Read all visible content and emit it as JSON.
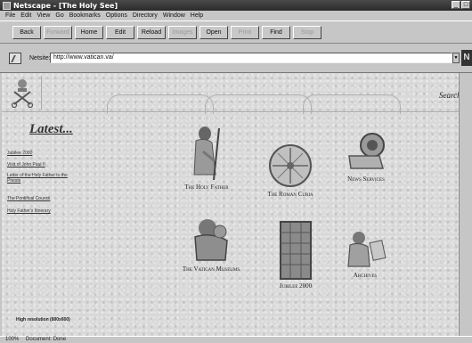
{
  "window": {
    "title": "Netscape - [The Holy See]"
  },
  "menu": [
    "File",
    "Edit",
    "View",
    "Go",
    "Bookmarks",
    "Options",
    "Directory",
    "Window",
    "Help"
  ],
  "toolbar": [
    {
      "label": "Back",
      "enabled": true
    },
    {
      "label": "Forward",
      "enabled": false
    },
    {
      "label": "Home",
      "enabled": true
    },
    {
      "label": "Edit",
      "enabled": true
    },
    {
      "label": "Reload",
      "enabled": true
    },
    {
      "label": "Images",
      "enabled": false
    },
    {
      "label": "Open",
      "enabled": true
    },
    {
      "label": "Print",
      "enabled": false
    },
    {
      "label": "Find",
      "enabled": true
    },
    {
      "label": "Stop",
      "enabled": false
    }
  ],
  "location": {
    "label": "Netsite:",
    "value": "http://www.vatican.va/"
  },
  "page": {
    "search_label": "Search",
    "latest_heading": "Latest...",
    "side_links": [
      "Jubilee 2000",
      "Visit of John Paul II",
      "Letter of the Holy Father to the Priests",
      "The Pontifical Council",
      "Holy Father's Itinerary"
    ],
    "icons": [
      {
        "label": "The Holy Father"
      },
      {
        "label": "The Roman Curia"
      },
      {
        "label": "News Services"
      },
      {
        "label": "The Vatican Museums"
      },
      {
        "label": "Jubilee 2000"
      },
      {
        "label": "Archives"
      }
    ],
    "high_res_note": "High resolution (800x600)"
  },
  "status": {
    "left": "100%",
    "text": "Document: Done"
  },
  "colors": {
    "chrome": "#c6c6c6",
    "titlebar": "#2a2a2a",
    "page_bg": "#d8d8d8"
  }
}
